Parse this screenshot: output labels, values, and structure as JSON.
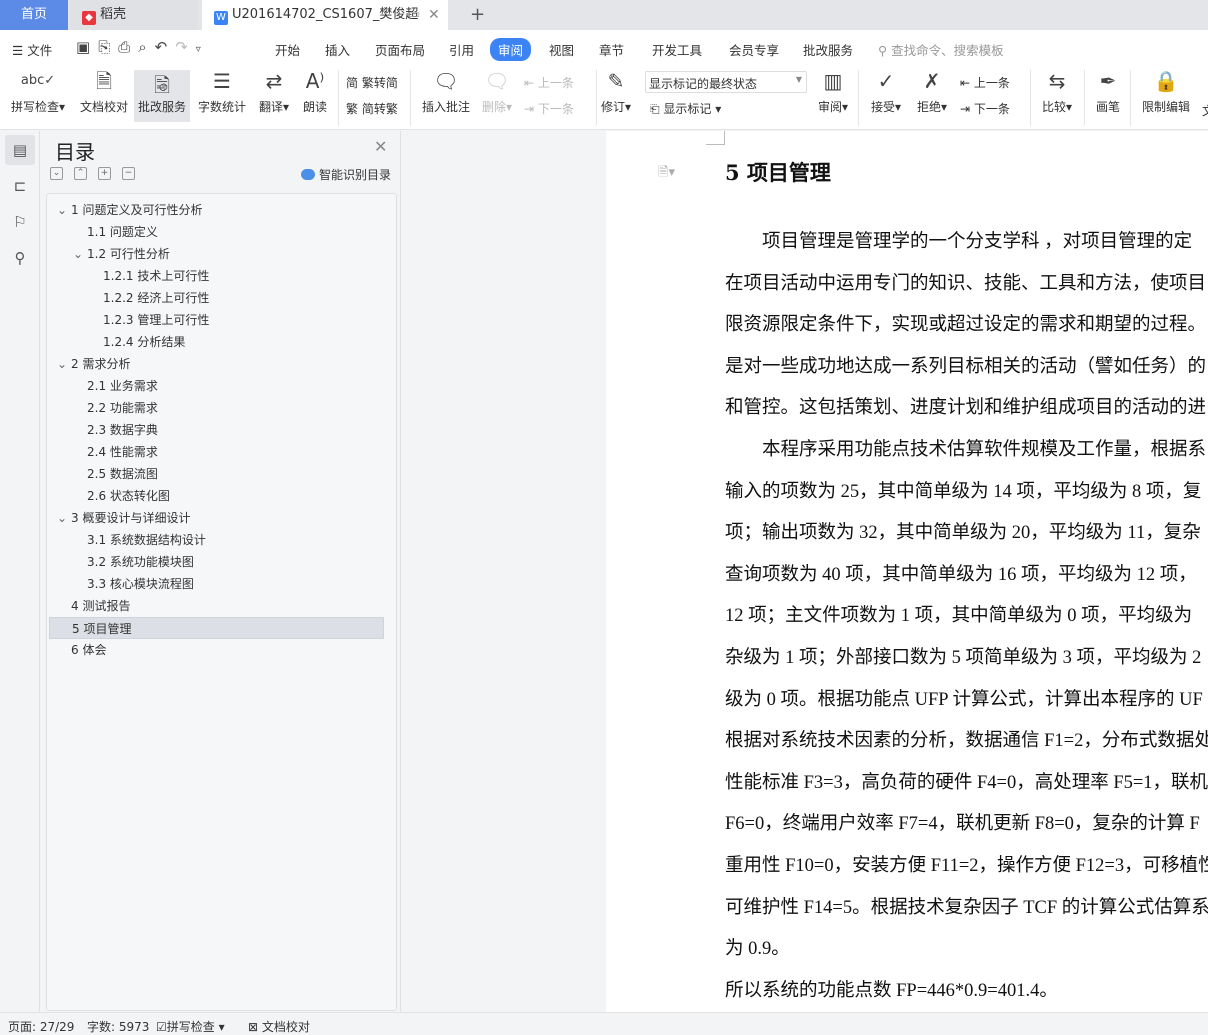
{
  "tabs": {
    "home": "首页",
    "daoke": "稻壳",
    "doc": "U201614702_CS1607_樊俊超",
    "new": "+"
  },
  "menu": {
    "file": "文件",
    "items": [
      "开始",
      "插入",
      "页面布局",
      "引用",
      "审阅",
      "视图",
      "章节",
      "开发工具",
      "会员专享",
      "批改服务"
    ],
    "search_placeholder": "查找命令、搜索模板"
  },
  "ribbon": {
    "spell": "拼写检查",
    "proof": "文档校对",
    "correct": "批改服务",
    "wordcount": "字数统计",
    "translate": "翻译",
    "read": "朗读",
    "t2s": "繁转简",
    "s2t": "简转繁",
    "insert_comment": "插入批注",
    "delete": "删除",
    "prev_c": "上一条",
    "next_c": "下一条",
    "track": "修订",
    "display_select": "显示标记的最终状态",
    "show_markup": "显示标记",
    "review": "审阅",
    "accept": "接受",
    "reject": "拒绝",
    "prev": "上一条",
    "next": "下一条",
    "compare": "比较",
    "pen": "画笔",
    "restrict": "限制编辑",
    "more": "文"
  },
  "accent": "#3c84f5",
  "toc": {
    "title": "目录",
    "smart": "智能识别目录",
    "items": [
      {
        "label": "1 问题定义及可行性分析",
        "level": 0,
        "expanded": true
      },
      {
        "label": "1.1 问题定义",
        "level": 1
      },
      {
        "label": "1.2 可行性分析",
        "level": 1,
        "expanded": true
      },
      {
        "label": "1.2.1 技术上可行性",
        "level": 2
      },
      {
        "label": "1.2.2 经济上可行性",
        "level": 2
      },
      {
        "label": "1.2.3 管理上可行性",
        "level": 2
      },
      {
        "label": "1.2.4 分析结果",
        "level": 2
      },
      {
        "label": "2 需求分析",
        "level": 0,
        "expanded": true
      },
      {
        "label": "2.1 业务需求",
        "level": 1
      },
      {
        "label": "2.2 功能需求",
        "level": 1
      },
      {
        "label": "2.3 数据字典",
        "level": 1
      },
      {
        "label": "2.4 性能需求",
        "level": 1
      },
      {
        "label": "2.5 数据流图",
        "level": 1
      },
      {
        "label": "2.6 状态转化图",
        "level": 1
      },
      {
        "label": "3 概要设计与详细设计",
        "level": 0,
        "expanded": true
      },
      {
        "label": "3.1 系统数据结构设计",
        "level": 1
      },
      {
        "label": "3.2 系统功能模块图",
        "level": 1
      },
      {
        "label": "3.3 核心模块流程图",
        "level": 1
      },
      {
        "label": "4 测试报告",
        "level": 0
      },
      {
        "label": "5 项目管理",
        "level": 0,
        "selected": true
      },
      {
        "label": "6 体会",
        "level": 0
      }
    ]
  },
  "doc": {
    "heading": "5 项目管理",
    "lines": [
      "　　项目管理是管理学的一个分支学科 ，对项目管理的定",
      "在项目活动中运用专门的知识、技能、工具和方法，使项目",
      "限资源限定条件下，实现或超过设定的需求和期望的过程。",
      "是对一些成功地达成一系列目标相关的活动（譬如任务）的",
      "和管控。这包括策划、进度计划和维护组成项目的活动的进",
      "　　本程序采用功能点技术估算软件规模及工作量，根据系",
      "输入的项数为 25，其中简单级为 14 项，平均级为 8 项，复",
      "项；输出项数为 32，其中简单级为 20，平均级为 11，复杂",
      "查询项数为 40 项，其中简单级为 16 项，平均级为 12 项，",
      "12 项；主文件项数为 1 项，其中简单级为 0 项，平均级为",
      "杂级为 1 项；外部接口数为 5 项简单级为 3 项，平均级为 2",
      "级为 0 项。根据功能点 UFP 计算公式，计算出本程序的 UF",
      "根据对系统技术因素的分析，数据通信 F1=2，分布式数据处",
      "性能标准 F3=3，高负荷的硬件 F4=0，高处理率 F5=1，联机",
      "F6=0，终端用户效率 F7=4，联机更新 F8=0，复杂的计算 F",
      "重用性 F10=0，安装方便 F11=2，操作方便 F12=3，可移植性",
      "可维护性 F14=5。根据技术复杂因子 TCF 的计算公式估算系",
      "为 0.9。",
      "所以系统的功能点数 FP=446*0.9=401.4。"
    ]
  },
  "status": {
    "page": "页面: 27/29",
    "words": "字数: 5973",
    "spell": "拼写检查",
    "proof": "文档校对"
  }
}
